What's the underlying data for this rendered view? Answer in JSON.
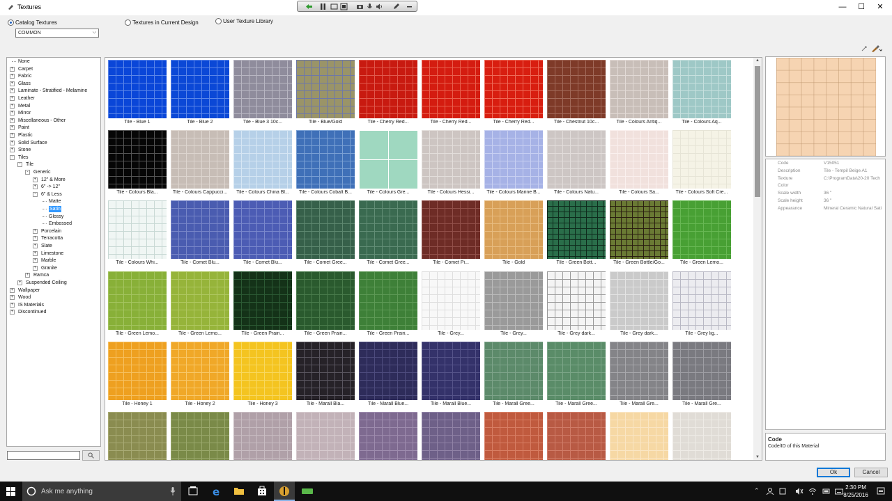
{
  "window": {
    "title": "Textures",
    "min": "—",
    "max": "☐",
    "close": "✕"
  },
  "options": {
    "catalog": "Catalog Textures",
    "current": "Textures in Current Design",
    "user": "User Texture Library",
    "category_value": "COMMON"
  },
  "tree": [
    {
      "label": "None",
      "level": 0,
      "expander": ""
    },
    {
      "label": "Carpet",
      "level": 0,
      "expander": "+"
    },
    {
      "label": "Fabric",
      "level": 0,
      "expander": "+"
    },
    {
      "label": "Glass",
      "level": 0,
      "expander": "+"
    },
    {
      "label": "Laminate - Stratified - Melamine",
      "level": 0,
      "expander": "+"
    },
    {
      "label": "Leather",
      "level": 0,
      "expander": "+"
    },
    {
      "label": "Metal",
      "level": 0,
      "expander": "+"
    },
    {
      "label": "Mirror",
      "level": 0,
      "expander": "+"
    },
    {
      "label": "Miscellaneous - Other",
      "level": 0,
      "expander": "+"
    },
    {
      "label": "Paint",
      "level": 0,
      "expander": "+"
    },
    {
      "label": "Plastic",
      "level": 0,
      "expander": "+"
    },
    {
      "label": "Solid Surface",
      "level": 0,
      "expander": "+"
    },
    {
      "label": "Stone",
      "level": 0,
      "expander": "+"
    },
    {
      "label": "Tiles",
      "level": 0,
      "expander": "-"
    },
    {
      "label": "Tile",
      "level": 1,
      "expander": "-"
    },
    {
      "label": "Generic",
      "level": 2,
      "expander": "-"
    },
    {
      "label": "12\" & More",
      "level": 3,
      "expander": "+"
    },
    {
      "label": "6\" -> 12\"",
      "level": 3,
      "expander": "+"
    },
    {
      "label": "6\" & Less",
      "level": 3,
      "expander": "-"
    },
    {
      "label": "Matte",
      "level": 4,
      "expander": ""
    },
    {
      "label": "Satin",
      "level": 4,
      "expander": "",
      "selected": true
    },
    {
      "label": "Glossy",
      "level": 4,
      "expander": ""
    },
    {
      "label": "Embossed",
      "level": 4,
      "expander": ""
    },
    {
      "label": "Porcelain",
      "level": 3,
      "expander": "+"
    },
    {
      "label": "Terracotta",
      "level": 3,
      "expander": "+"
    },
    {
      "label": "Slate",
      "level": 3,
      "expander": "+"
    },
    {
      "label": "Limestone",
      "level": 3,
      "expander": "+"
    },
    {
      "label": "Marble",
      "level": 3,
      "expander": "+"
    },
    {
      "label": "Granite",
      "level": 3,
      "expander": "+"
    },
    {
      "label": "Ramca",
      "level": 2,
      "expander": "+"
    },
    {
      "label": "Suspended Ceiling",
      "level": 1,
      "expander": "+"
    },
    {
      "label": "Wallpaper",
      "level": 0,
      "expander": "+"
    },
    {
      "label": "Wood",
      "level": 0,
      "expander": "+"
    },
    {
      "label": "IS Materials",
      "level": 0,
      "expander": "+"
    },
    {
      "label": "Discontinued",
      "level": 0,
      "expander": "+"
    }
  ],
  "textures": [
    {
      "label": "Tile - Blue 1",
      "color": "#0a46d8",
      "grid": "#5b86e8"
    },
    {
      "label": "Tile - Blue 2",
      "color": "#0b48d6",
      "grid": "#5b86e8"
    },
    {
      "label": "Tile - Blue 3 10c...",
      "color": "#8f8c9c",
      "grid": "#b8b6c2"
    },
    {
      "label": "Tile - Blue/Gold",
      "color": "#9a9468",
      "grid": "#6e78a8"
    },
    {
      "label": "Tile - Cherry Red...",
      "color": "#c81a10",
      "grid": "#e05a4e"
    },
    {
      "label": "Tile - Cherry Red...",
      "color": "#d41c10",
      "grid": "#e8604e"
    },
    {
      "label": "Tile - Cherry Red...",
      "color": "#d81e10",
      "grid": "#ee6a58"
    },
    {
      "label": "Tile - Chestnut 10c...",
      "color": "#7e3a28",
      "grid": "#a26a5a"
    },
    {
      "label": "Tile - Colours Antiq...",
      "color": "#c8beb8",
      "grid": "#e2dad6"
    },
    {
      "label": "Tile - Colours Aq...",
      "color": "#9ec8c6",
      "grid": "#c6e0de"
    },
    {
      "label": "Tile - Colours Bla...",
      "color": "#060606",
      "grid": "#555555"
    },
    {
      "label": "Tile - Colours Cappucci...",
      "color": "#c7bdb6",
      "grid": "#ddd5cf"
    },
    {
      "label": "Tile - Colours China Bl...",
      "color": "#b6d0e8",
      "grid": "#d6e6f4"
    },
    {
      "label": "Tile - Colours Cobalt B...",
      "color": "#3f70b8",
      "grid": "#7aa0d4"
    },
    {
      "label": "Tile - Colours Gre...",
      "color": "#9fd8c0",
      "grid": "#ffffff"
    },
    {
      "label": "Tile - Colours Hessi...",
      "color": "#cdc5c2",
      "grid": "#e3dedb"
    },
    {
      "label": "Tile - Colours Marine B...",
      "color": "#a6b2e6",
      "grid": "#c8d0f2"
    },
    {
      "label": "Tile - Colours Natu...",
      "color": "#cdc6c4",
      "grid": "#e2dddb"
    },
    {
      "label": "Tile - Colours Sa...",
      "color": "#f1e1dd",
      "grid": "#faf0ee"
    },
    {
      "label": "Tile - Colours Soft Cre...",
      "color": "#f5f3e6",
      "grid": "#e6e4d6"
    },
    {
      "label": "Tile - Colours Whi...",
      "color": "#f0f6f4",
      "grid": "#c8d8d4"
    },
    {
      "label": "Tile - Comet Blu...",
      "color": "#4a5cb0",
      "grid": "#7886c8"
    },
    {
      "label": "Tile - Comet Blu...",
      "color": "#4c5cb4",
      "grid": "#7a88cc"
    },
    {
      "label": "Tile - Comet Gree...",
      "color": "#36604a",
      "grid": "#5e8870"
    },
    {
      "label": "Tile - Comet Gree...",
      "color": "#3a6a50",
      "grid": "#628e76"
    },
    {
      "label": "Tile - Comet Pi...",
      "color": "#6e2c26",
      "grid": "#92504a"
    },
    {
      "label": "Tile - Gold",
      "color": "#d8a058",
      "grid": "#e8bc80"
    },
    {
      "label": "Tile - Green Bott...",
      "color": "#2a6e4a",
      "grid": "#0e2a1c"
    },
    {
      "label": "Tile - Green Bottle/Go...",
      "color": "#6a7a34",
      "grid": "#2a1e10"
    },
    {
      "label": "Tile - Green Lemo...",
      "color": "#48a034",
      "grid": "#68b854"
    },
    {
      "label": "Tile - Green Lemo...",
      "color": "#88b038",
      "grid": "#a4c460"
    },
    {
      "label": "Tile - Green Lemo...",
      "color": "#96b43a",
      "grid": "#b0c862"
    },
    {
      "label": "Tile - Green Prairi...",
      "color": "#143218",
      "grid": "#2c5a34"
    },
    {
      "label": "Tile - Green Prairi...",
      "color": "#2a5a2e",
      "grid": "#4a7c4c"
    },
    {
      "label": "Tile - Green Prairi...",
      "color": "#3e8038",
      "grid": "#5e9a56"
    },
    {
      "label": "Tile - Grey...",
      "color": "#f8f8f8",
      "grid": "#dedede"
    },
    {
      "label": "Tile - Grey...",
      "color": "#9a9a9a",
      "grid": "#bcbcbc"
    },
    {
      "label": "Tile - Grey dark...",
      "color": "#f4f4f4",
      "grid": "#9a9a9a"
    },
    {
      "label": "Tile - Grey dark...",
      "color": "#cacaca",
      "grid": "#e4e4e4"
    },
    {
      "label": "Tile - Grey lig...",
      "color": "#ececf0",
      "grid": "#b8b8c4"
    },
    {
      "label": "Tile - Honey 1",
      "color": "#eea020",
      "grid": "#f6c060"
    },
    {
      "label": "Tile - Honey 2",
      "color": "#f0a828",
      "grid": "#f8c86a"
    },
    {
      "label": "Tile - Honey 3",
      "color": "#f4c420",
      "grid": "#f8d860"
    },
    {
      "label": "Tile - Marall Bla...",
      "color": "#262228",
      "grid": "#5a5660"
    },
    {
      "label": "Tile - Marall Blue...",
      "color": "#2e2c5a",
      "grid": "#4e4c7e"
    },
    {
      "label": "Tile - Marall Blue...",
      "color": "#34326a",
      "grid": "#56548a"
    },
    {
      "label": "Tile - Marall Gree...",
      "color": "#5c8a6a",
      "grid": "#7ea48a"
    },
    {
      "label": "Tile - Marall Gree...",
      "color": "#5a8c68",
      "grid": "#7ca688"
    },
    {
      "label": "Tile - Marall Gre...",
      "color": "#848488",
      "grid": "#a8a8ac"
    },
    {
      "label": "Tile - Marall Gre...",
      "color": "#7a7a80",
      "grid": "#9e9ea4"
    },
    {
      "label": "",
      "color": "#8a8c50",
      "grid": "#a8aa74"
    },
    {
      "label": "",
      "color": "#7a8a48",
      "grid": "#9aa86c"
    },
    {
      "label": "",
      "color": "#b0a0a8",
      "grid": "#c8bcc2"
    },
    {
      "label": "",
      "color": "#c2b2b8",
      "grid": "#d6cace"
    },
    {
      "label": "",
      "color": "#7e6a90",
      "grid": "#9e8cae"
    },
    {
      "label": "",
      "color": "#6e6088",
      "grid": "#9082a6"
    },
    {
      "label": "",
      "color": "#c05a3e",
      "grid": "#d87e64"
    },
    {
      "label": "",
      "color": "#b85a44",
      "grid": "#d07c68"
    },
    {
      "label": "",
      "color": "#f6d8a4",
      "grid": "#fae6c4"
    },
    {
      "label": "",
      "color": "#e0dcd6",
      "grid": "#eeebe6"
    }
  ],
  "details": {
    "rows": [
      {
        "key": "Code",
        "value": "V15051"
      },
      {
        "key": "Description",
        "value": "Tile - Tempil Beige A1"
      },
      {
        "key": "Texture",
        "value": "C:\\ProgramData\\20-20 Tech"
      },
      {
        "key": "Color",
        "value": ""
      },
      {
        "key": "Scale width",
        "value": "36 \""
      },
      {
        "key": "Scale height",
        "value": "36 \""
      },
      {
        "key": "Appearance",
        "value": "Mineral Ceramic Natural Sati"
      }
    ],
    "desc_title": "Code",
    "desc_text": "Code/ID of this Material"
  },
  "buttons": {
    "ok": "Ok",
    "cancel": "Cancel"
  },
  "taskbar": {
    "search_placeholder": "Ask me anything",
    "time": "2:30 PM",
    "date": "8/25/2016"
  },
  "colors": {
    "selection": "#3399ff",
    "taskbar": "#101010",
    "accent": "#0078d7"
  }
}
